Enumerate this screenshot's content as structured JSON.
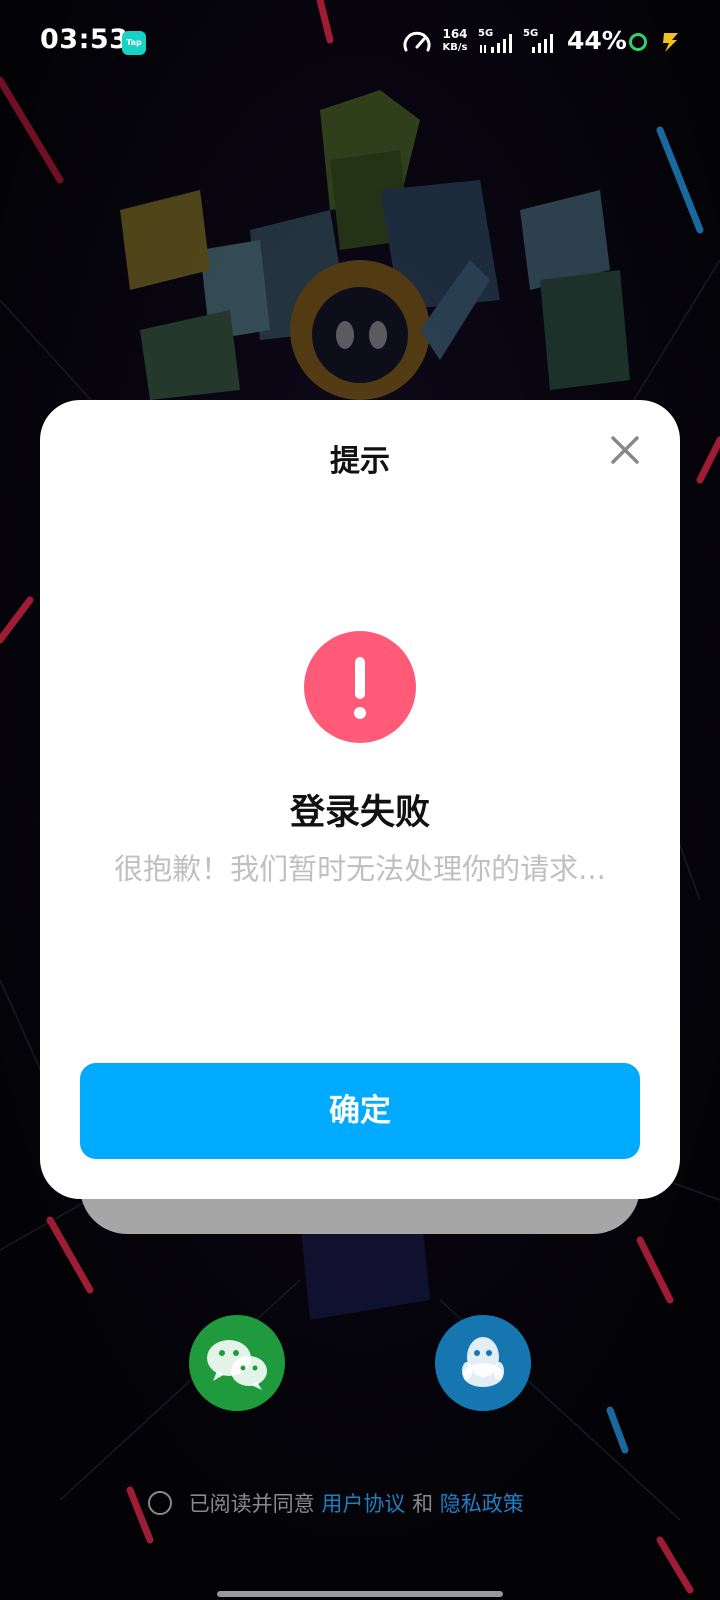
{
  "status_bar": {
    "time": "03:53",
    "app_badge": "Tap",
    "net_speed_value": "164",
    "net_speed_unit": "KB/s",
    "sim1": "5G",
    "sim2": "5G",
    "battery": "44%"
  },
  "dialog": {
    "title": "提示",
    "heading": "登录失败",
    "message": "很抱歉！我们暂时无法处理你的请求...",
    "confirm_label": "确定",
    "icon": "exclamation-icon",
    "icon_color": "#ff5b78",
    "accent": "#00aaff"
  },
  "social": {
    "wechat_icon": "wechat-icon",
    "qq_icon": "qq-icon"
  },
  "agreement": {
    "prefix": "已阅读并同意",
    "user_agreement": "用户协议",
    "and": "和",
    "privacy_policy": "隐私政策"
  }
}
